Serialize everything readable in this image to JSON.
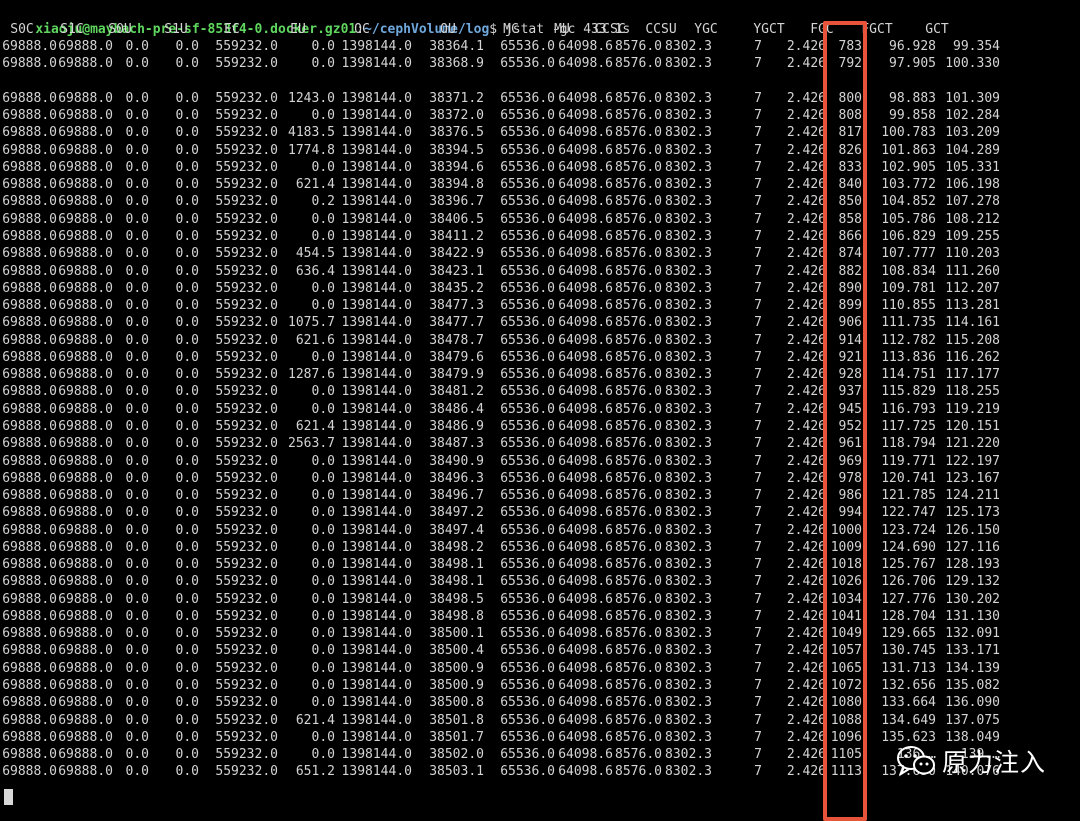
{
  "terminal": {
    "prompt": {
      "user": "xiaoju",
      "at": "@",
      "host": "maybach-pre-sf-853f4-0.docker.gz01",
      "colon": ":",
      "path": "~/cephVolume/log",
      "symbol": "$",
      "command": " jstat -gc 433 1s"
    },
    "columns": [
      "S0C",
      "S1C",
      "S0U",
      "S1U",
      "EC",
      "EU",
      "OC",
      "OU",
      "MC",
      "MU",
      "CCSC",
      "CCSU",
      "YGC",
      "YGCT",
      "FGC",
      "FGCT",
      "GCT"
    ],
    "rows": [
      [
        "69888.0",
        "69888.0",
        "0.0",
        "0.0",
        "559232.0",
        "0.0",
        "1398144.0",
        "38364.1",
        "65536.0",
        "64098.6",
        "8576.0",
        "8302.3",
        "7",
        "2.426",
        "783",
        "96.928",
        "99.354"
      ],
      [
        "69888.0",
        "69888.0",
        "0.0",
        "0.0",
        "559232.0",
        "0.0",
        "1398144.0",
        "38368.9",
        "65536.0",
        "64098.6",
        "8576.0",
        "8302.3",
        "7",
        "2.426",
        "792",
        "97.905",
        "100.330"
      ],
      null,
      [
        "69888.0",
        "69888.0",
        "0.0",
        "0.0",
        "559232.0",
        "1243.0",
        "1398144.0",
        "38371.2",
        "65536.0",
        "64098.6",
        "8576.0",
        "8302.3",
        "7",
        "2.426",
        "800",
        "98.883",
        "101.309"
      ],
      [
        "69888.0",
        "69888.0",
        "0.0",
        "0.0",
        "559232.0",
        "0.0",
        "1398144.0",
        "38372.0",
        "65536.0",
        "64098.6",
        "8576.0",
        "8302.3",
        "7",
        "2.426",
        "808",
        "99.858",
        "102.284"
      ],
      [
        "69888.0",
        "69888.0",
        "0.0",
        "0.0",
        "559232.0",
        "4183.5",
        "1398144.0",
        "38376.5",
        "65536.0",
        "64098.6",
        "8576.0",
        "8302.3",
        "7",
        "2.426",
        "817",
        "100.783",
        "103.209"
      ],
      [
        "69888.0",
        "69888.0",
        "0.0",
        "0.0",
        "559232.0",
        "1774.8",
        "1398144.0",
        "38394.5",
        "65536.0",
        "64098.6",
        "8576.0",
        "8302.3",
        "7",
        "2.426",
        "826",
        "101.863",
        "104.289"
      ],
      [
        "69888.0",
        "69888.0",
        "0.0",
        "0.0",
        "559232.0",
        "0.0",
        "1398144.0",
        "38394.6",
        "65536.0",
        "64098.6",
        "8576.0",
        "8302.3",
        "7",
        "2.426",
        "833",
        "102.905",
        "105.331"
      ],
      [
        "69888.0",
        "69888.0",
        "0.0",
        "0.0",
        "559232.0",
        "621.4",
        "1398144.0",
        "38394.8",
        "65536.0",
        "64098.6",
        "8576.0",
        "8302.3",
        "7",
        "2.426",
        "840",
        "103.772",
        "106.198"
      ],
      [
        "69888.0",
        "69888.0",
        "0.0",
        "0.0",
        "559232.0",
        "0.2",
        "1398144.0",
        "38396.7",
        "65536.0",
        "64098.6",
        "8576.0",
        "8302.3",
        "7",
        "2.426",
        "850",
        "104.852",
        "107.278"
      ],
      [
        "69888.0",
        "69888.0",
        "0.0",
        "0.0",
        "559232.0",
        "0.0",
        "1398144.0",
        "38406.5",
        "65536.0",
        "64098.6",
        "8576.0",
        "8302.3",
        "7",
        "2.426",
        "858",
        "105.786",
        "108.212"
      ],
      [
        "69888.0",
        "69888.0",
        "0.0",
        "0.0",
        "559232.0",
        "0.0",
        "1398144.0",
        "38411.2",
        "65536.0",
        "64098.6",
        "8576.0",
        "8302.3",
        "7",
        "2.426",
        "866",
        "106.829",
        "109.255"
      ],
      [
        "69888.0",
        "69888.0",
        "0.0",
        "0.0",
        "559232.0",
        "454.5",
        "1398144.0",
        "38422.9",
        "65536.0",
        "64098.6",
        "8576.0",
        "8302.3",
        "7",
        "2.426",
        "874",
        "107.777",
        "110.203"
      ],
      [
        "69888.0",
        "69888.0",
        "0.0",
        "0.0",
        "559232.0",
        "636.4",
        "1398144.0",
        "38423.1",
        "65536.0",
        "64098.6",
        "8576.0",
        "8302.3",
        "7",
        "2.426",
        "882",
        "108.834",
        "111.260"
      ],
      [
        "69888.0",
        "69888.0",
        "0.0",
        "0.0",
        "559232.0",
        "0.0",
        "1398144.0",
        "38435.2",
        "65536.0",
        "64098.6",
        "8576.0",
        "8302.3",
        "7",
        "2.426",
        "890",
        "109.781",
        "112.207"
      ],
      [
        "69888.0",
        "69888.0",
        "0.0",
        "0.0",
        "559232.0",
        "0.0",
        "1398144.0",
        "38477.3",
        "65536.0",
        "64098.6",
        "8576.0",
        "8302.3",
        "7",
        "2.426",
        "899",
        "110.855",
        "113.281"
      ],
      [
        "69888.0",
        "69888.0",
        "0.0",
        "0.0",
        "559232.0",
        "1075.7",
        "1398144.0",
        "38477.7",
        "65536.0",
        "64098.6",
        "8576.0",
        "8302.3",
        "7",
        "2.426",
        "906",
        "111.735",
        "114.161"
      ],
      [
        "69888.0",
        "69888.0",
        "0.0",
        "0.0",
        "559232.0",
        "621.6",
        "1398144.0",
        "38478.7",
        "65536.0",
        "64098.6",
        "8576.0",
        "8302.3",
        "7",
        "2.426",
        "914",
        "112.782",
        "115.208"
      ],
      [
        "69888.0",
        "69888.0",
        "0.0",
        "0.0",
        "559232.0",
        "0.0",
        "1398144.0",
        "38479.6",
        "65536.0",
        "64098.6",
        "8576.0",
        "8302.3",
        "7",
        "2.426",
        "921",
        "113.836",
        "116.262"
      ],
      [
        "69888.0",
        "69888.0",
        "0.0",
        "0.0",
        "559232.0",
        "1287.6",
        "1398144.0",
        "38479.9",
        "65536.0",
        "64098.6",
        "8576.0",
        "8302.3",
        "7",
        "2.426",
        "928",
        "114.751",
        "117.177"
      ],
      [
        "69888.0",
        "69888.0",
        "0.0",
        "0.0",
        "559232.0",
        "0.0",
        "1398144.0",
        "38481.2",
        "65536.0",
        "64098.6",
        "8576.0",
        "8302.3",
        "7",
        "2.426",
        "937",
        "115.829",
        "118.255"
      ],
      [
        "69888.0",
        "69888.0",
        "0.0",
        "0.0",
        "559232.0",
        "0.0",
        "1398144.0",
        "38486.4",
        "65536.0",
        "64098.6",
        "8576.0",
        "8302.3",
        "7",
        "2.426",
        "945",
        "116.793",
        "119.219"
      ],
      [
        "69888.0",
        "69888.0",
        "0.0",
        "0.0",
        "559232.0",
        "621.4",
        "1398144.0",
        "38486.9",
        "65536.0",
        "64098.6",
        "8576.0",
        "8302.3",
        "7",
        "2.426",
        "952",
        "117.725",
        "120.151"
      ],
      [
        "69888.0",
        "69888.0",
        "0.0",
        "0.0",
        "559232.0",
        "2563.7",
        "1398144.0",
        "38487.3",
        "65536.0",
        "64098.6",
        "8576.0",
        "8302.3",
        "7",
        "2.426",
        "961",
        "118.794",
        "121.220"
      ],
      [
        "69888.0",
        "69888.0",
        "0.0",
        "0.0",
        "559232.0",
        "0.0",
        "1398144.0",
        "38490.9",
        "65536.0",
        "64098.6",
        "8576.0",
        "8302.3",
        "7",
        "2.426",
        "969",
        "119.771",
        "122.197"
      ],
      [
        "69888.0",
        "69888.0",
        "0.0",
        "0.0",
        "559232.0",
        "0.0",
        "1398144.0",
        "38496.3",
        "65536.0",
        "64098.6",
        "8576.0",
        "8302.3",
        "7",
        "2.426",
        "978",
        "120.741",
        "123.167"
      ],
      [
        "69888.0",
        "69888.0",
        "0.0",
        "0.0",
        "559232.0",
        "0.0",
        "1398144.0",
        "38496.7",
        "65536.0",
        "64098.6",
        "8576.0",
        "8302.3",
        "7",
        "2.426",
        "986",
        "121.785",
        "124.211"
      ],
      [
        "69888.0",
        "69888.0",
        "0.0",
        "0.0",
        "559232.0",
        "0.0",
        "1398144.0",
        "38497.2",
        "65536.0",
        "64098.6",
        "8576.0",
        "8302.3",
        "7",
        "2.426",
        "994",
        "122.747",
        "125.173"
      ],
      [
        "69888.0",
        "69888.0",
        "0.0",
        "0.0",
        "559232.0",
        "0.0",
        "1398144.0",
        "38497.4",
        "65536.0",
        "64098.6",
        "8576.0",
        "8302.3",
        "7",
        "2.426",
        "1000",
        "123.724",
        "126.150"
      ],
      [
        "69888.0",
        "69888.0",
        "0.0",
        "0.0",
        "559232.0",
        "0.0",
        "1398144.0",
        "38498.2",
        "65536.0",
        "64098.6",
        "8576.0",
        "8302.3",
        "7",
        "2.426",
        "1009",
        "124.690",
        "127.116"
      ],
      [
        "69888.0",
        "69888.0",
        "0.0",
        "0.0",
        "559232.0",
        "0.0",
        "1398144.0",
        "38498.1",
        "65536.0",
        "64098.6",
        "8576.0",
        "8302.3",
        "7",
        "2.426",
        "1018",
        "125.767",
        "128.193"
      ],
      [
        "69888.0",
        "69888.0",
        "0.0",
        "0.0",
        "559232.0",
        "0.0",
        "1398144.0",
        "38498.1",
        "65536.0",
        "64098.6",
        "8576.0",
        "8302.3",
        "7",
        "2.426",
        "1026",
        "126.706",
        "129.132"
      ],
      [
        "69888.0",
        "69888.0",
        "0.0",
        "0.0",
        "559232.0",
        "0.0",
        "1398144.0",
        "38498.5",
        "65536.0",
        "64098.6",
        "8576.0",
        "8302.3",
        "7",
        "2.426",
        "1034",
        "127.776",
        "130.202"
      ],
      [
        "69888.0",
        "69888.0",
        "0.0",
        "0.0",
        "559232.0",
        "0.0",
        "1398144.0",
        "38498.8",
        "65536.0",
        "64098.6",
        "8576.0",
        "8302.3",
        "7",
        "2.426",
        "1041",
        "128.704",
        "131.130"
      ],
      [
        "69888.0",
        "69888.0",
        "0.0",
        "0.0",
        "559232.0",
        "0.0",
        "1398144.0",
        "38500.1",
        "65536.0",
        "64098.6",
        "8576.0",
        "8302.3",
        "7",
        "2.426",
        "1049",
        "129.665",
        "132.091"
      ],
      [
        "69888.0",
        "69888.0",
        "0.0",
        "0.0",
        "559232.0",
        "0.0",
        "1398144.0",
        "38500.4",
        "65536.0",
        "64098.6",
        "8576.0",
        "8302.3",
        "7",
        "2.426",
        "1057",
        "130.745",
        "133.171"
      ],
      [
        "69888.0",
        "69888.0",
        "0.0",
        "0.0",
        "559232.0",
        "0.0",
        "1398144.0",
        "38500.9",
        "65536.0",
        "64098.6",
        "8576.0",
        "8302.3",
        "7",
        "2.426",
        "1065",
        "131.713",
        "134.139"
      ],
      [
        "69888.0",
        "69888.0",
        "0.0",
        "0.0",
        "559232.0",
        "0.0",
        "1398144.0",
        "38500.9",
        "65536.0",
        "64098.6",
        "8576.0",
        "8302.3",
        "7",
        "2.426",
        "1072",
        "132.656",
        "135.082"
      ],
      [
        "69888.0",
        "69888.0",
        "0.0",
        "0.0",
        "559232.0",
        "0.0",
        "1398144.0",
        "38500.8",
        "65536.0",
        "64098.6",
        "8576.0",
        "8302.3",
        "7",
        "2.426",
        "1080",
        "133.664",
        "136.090"
      ],
      [
        "69888.0",
        "69888.0",
        "0.0",
        "0.0",
        "559232.0",
        "621.4",
        "1398144.0",
        "38501.8",
        "65536.0",
        "64098.6",
        "8576.0",
        "8302.3",
        "7",
        "2.426",
        "1088",
        "134.649",
        "137.075"
      ],
      [
        "69888.0",
        "69888.0",
        "0.0",
        "0.0",
        "559232.0",
        "0.0",
        "1398144.0",
        "38501.7",
        "65536.0",
        "64098.6",
        "8576.0",
        "8302.3",
        "7",
        "2.426",
        "1096",
        "135.623",
        "138.049"
      ],
      [
        "69888.0",
        "69888.0",
        "0.0",
        "0.0",
        "559232.0",
        "0.0",
        "1398144.0",
        "38502.0",
        "65536.0",
        "64098.6",
        "8576.0",
        "8302.3",
        "7",
        "2.426",
        "1105",
        "136.…",
        "139.…"
      ],
      [
        "69888.0",
        "69888.0",
        "0.0",
        "0.0",
        "559232.0",
        "651.2",
        "1398144.0",
        "38503.1",
        "65536.0",
        "64098.6",
        "8576.0",
        "8302.3",
        "7",
        "2.426",
        "1113",
        "137.650",
        "140.076"
      ]
    ]
  },
  "watermark": {
    "icon": "wechat-icon",
    "text": "原力注入"
  },
  "colors": {
    "background": "#000000",
    "text": "#d4d4d4",
    "prompt_green": "#5fd75f",
    "prompt_path": "#6fa8dc",
    "highlight": "#e8543a"
  }
}
